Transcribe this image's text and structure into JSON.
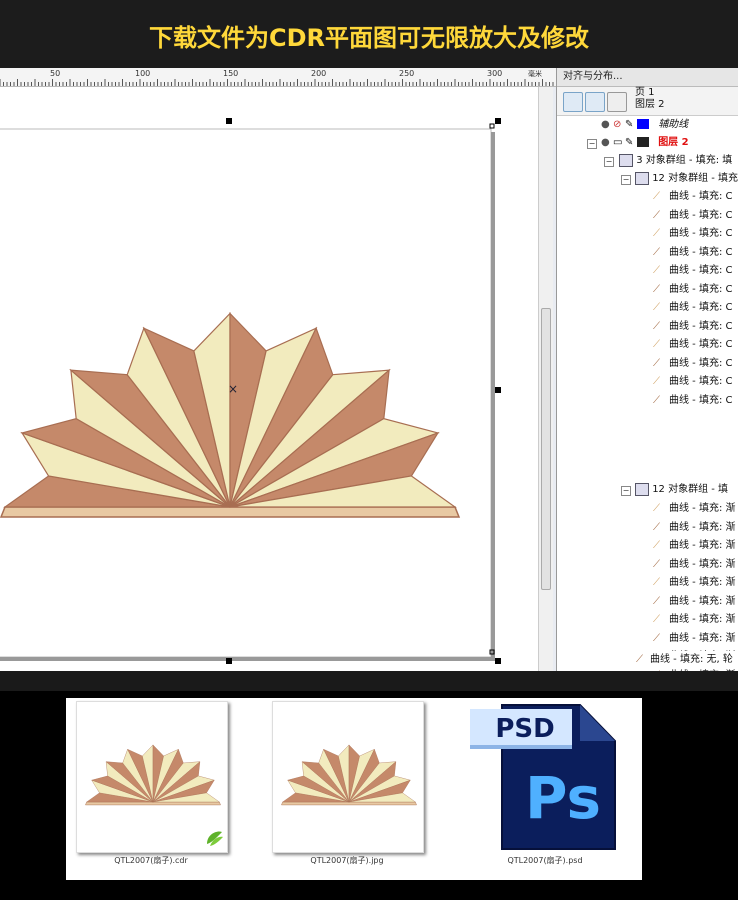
{
  "banner": {
    "title": "下载文件为CDR平面图可无限放大及修改"
  },
  "ruler": {
    "labels": [
      "50",
      "100",
      "150",
      "200",
      "250",
      "300"
    ],
    "unit": "毫米"
  },
  "panel": {
    "header": "对齐与分布...",
    "page": "页 1",
    "layer_current": "图层 2",
    "layer_guides": "辅助线",
    "layer_2": "图层 2",
    "group_3": "3 对象群组 - 填充: 填",
    "group_12a": "12 对象群组 - 填充: 填",
    "group_12b": "12 对象群组 - 填",
    "curve_c": "曲线 - 填充: C",
    "curve_fill": "曲线 - 填充: 渐",
    "curve_last": "曲线 - 填充: 无, 轮"
  },
  "files": [
    {
      "name": "QTL2007(扇子).cdr"
    },
    {
      "name": "QTL2007(扇子).jpg"
    },
    {
      "name": "QTL2007(扇子).psd"
    }
  ],
  "psd_label": "PSD",
  "ps_label": "Ps",
  "colors": {
    "fan_dark": "#c5896a",
    "fan_light": "#f2ebbe",
    "fan_stroke": "#a86e52",
    "banner_text": "#ffd83a"
  }
}
